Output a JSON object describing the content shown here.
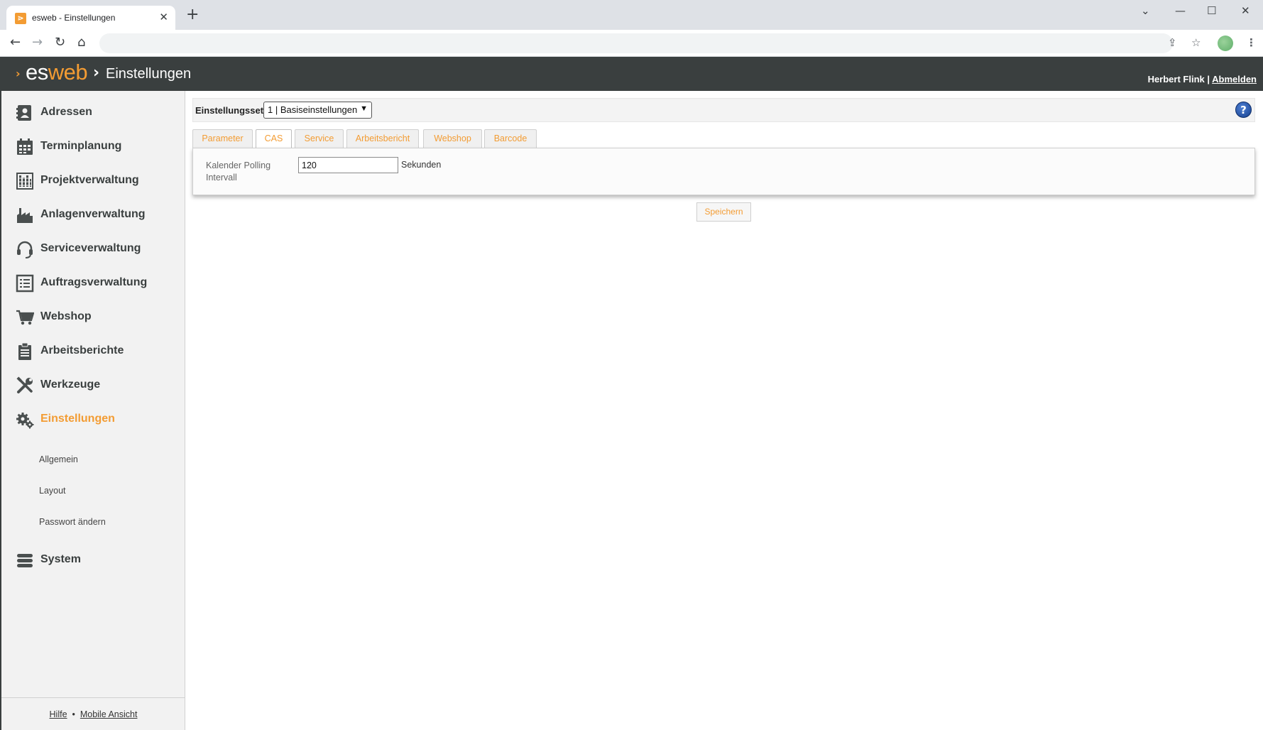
{
  "browser": {
    "tab_title": "esweb - Einstellungen",
    "favicon_glyph": "⋗"
  },
  "app": {
    "logo_es": "es",
    "logo_web": "web",
    "breadcrumb": "Einstellungen",
    "user_name": "Herbert Flink",
    "user_separator": "|",
    "logout": "Abmelden",
    "accent_color": "#f39c33",
    "header_color": "#3a3f3f"
  },
  "sidebar": {
    "items": [
      {
        "label": "Adressen",
        "icon": "address-book-icon"
      },
      {
        "label": "Terminplanung",
        "icon": "calendar-icon"
      },
      {
        "label": "Projektverwaltung",
        "icon": "project-icon"
      },
      {
        "label": "Anlagenverwaltung",
        "icon": "factory-icon"
      },
      {
        "label": "Serviceverwaltung",
        "icon": "headset-icon"
      },
      {
        "label": "Auftragsverwaltung",
        "icon": "list-icon"
      },
      {
        "label": "Webshop",
        "icon": "cart-icon"
      },
      {
        "label": "Arbeitsberichte",
        "icon": "clipboard-icon"
      },
      {
        "label": "Werkzeuge",
        "icon": "tools-icon"
      },
      {
        "label": "Einstellungen",
        "icon": "gears-icon"
      }
    ],
    "sub_items": [
      "Allgemein",
      "Layout",
      "Passwort ändern"
    ],
    "system": {
      "label": "System",
      "icon": "database-icon"
    },
    "footer": {
      "help": "Hilfe",
      "bullet": "•",
      "mobile": "Mobile Ansicht"
    }
  },
  "settings": {
    "set_label": "Einstellungsset",
    "set_value": "1 | Basiseinstellungen",
    "help_glyph": "?",
    "tabs": [
      "Parameter",
      "CAS",
      "Service",
      "Arbeitsbericht",
      "Webshop",
      "Barcode"
    ],
    "active_tab": "CAS",
    "field": {
      "label": "Kalender Polling Intervall",
      "value": "120",
      "unit": "Sekunden"
    },
    "save_label": "Speichern"
  }
}
